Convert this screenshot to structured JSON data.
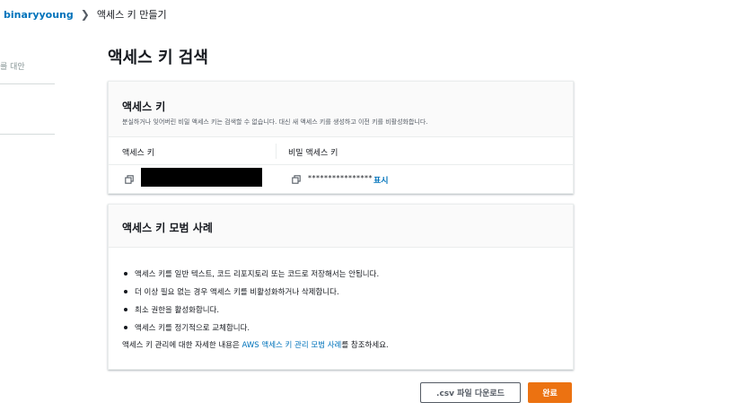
{
  "breadcrumb": {
    "user": "binaryyoung",
    "current": "액세스 키 만들기"
  },
  "side": {
    "fragment": "를 대안"
  },
  "page": {
    "title": "액세스 키 검색"
  },
  "access_key_card": {
    "title": "액세스 키",
    "description": "분실하거나 잊어버린 비밀 액세스 키는 검색할 수 없습니다. 대신 새 액세스 키를 생성하고 이전 키를 비활성화합니다.",
    "col_access_key": "액세스 키",
    "col_secret_key": "비밀 액세스 키",
    "secret_masked": "****************",
    "show_label": "표시"
  },
  "best_practices": {
    "title": "액세스 키 모범 사례",
    "items": [
      "액세스 키를 일반 텍스트, 코드 리포지토리 또는 코드로 저장해서는 안됩니다.",
      "더 이상 필요 없는 경우 액세스 키를 비활성화하거나 삭제합니다.",
      "최소 권한을 활성화합니다.",
      "액세스 키를 정기적으로 교체합니다."
    ],
    "ref_prefix": "액세스 키 관리에 대한 자세한 내용은 ",
    "ref_link": "AWS 액세스 키 관리 모범 사례",
    "ref_suffix": "를 참조하세요."
  },
  "actions": {
    "download_csv": ".csv 파일 다운로드",
    "done": "완료"
  },
  "colors": {
    "accent": "#ec7211",
    "link": "#0073bb"
  },
  "icons": {
    "copy": "copy-icon",
    "chevron": "chevron-right-icon"
  }
}
